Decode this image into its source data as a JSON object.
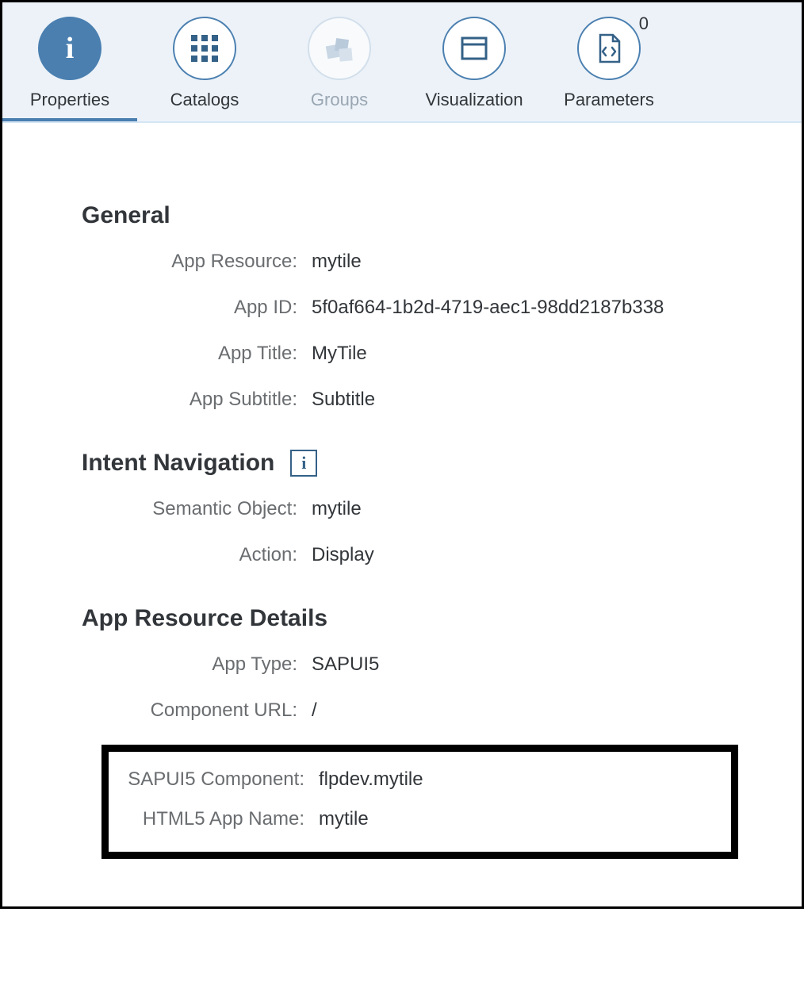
{
  "tabs": {
    "properties": {
      "label": "Properties"
    },
    "catalogs": {
      "label": "Catalogs"
    },
    "groups": {
      "label": "Groups"
    },
    "visualization": {
      "label": "Visualization"
    },
    "parameters": {
      "label": "Parameters",
      "badge": "0"
    }
  },
  "sections": {
    "general": {
      "heading": "General",
      "fields": {
        "app_resource": {
          "label": "App Resource:",
          "value": "mytile"
        },
        "app_id": {
          "label": "App ID:",
          "value": "5f0af664-1b2d-4719-aec1-98dd2187b338"
        },
        "app_title": {
          "label": "App Title:",
          "value": "MyTile"
        },
        "app_subtitle": {
          "label": "App Subtitle:",
          "value": "Subtitle"
        }
      }
    },
    "intent_navigation": {
      "heading": "Intent Navigation",
      "fields": {
        "semantic_object": {
          "label": "Semantic Object:",
          "value": "mytile"
        },
        "action": {
          "label": "Action:",
          "value": "Display"
        }
      }
    },
    "app_resource_details": {
      "heading": "App Resource Details",
      "fields": {
        "app_type": {
          "label": "App Type:",
          "value": "SAPUI5"
        },
        "component_url": {
          "label": "Component URL:",
          "value": "/"
        },
        "sapui5_component": {
          "label": "SAPUI5 Component:",
          "value": "flpdev.mytile"
        },
        "html5_app_name": {
          "label": "HTML5 App Name:",
          "value": "mytile"
        }
      }
    }
  },
  "info_icon_label": "i"
}
